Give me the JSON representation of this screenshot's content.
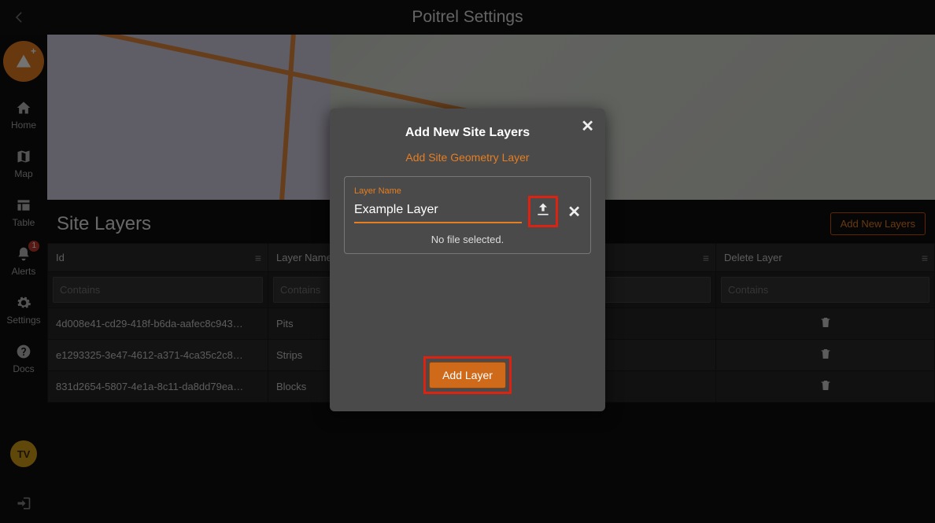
{
  "header": {
    "title": "Poitrel Settings"
  },
  "sidebar": {
    "items": [
      {
        "label": "Home"
      },
      {
        "label": "Map"
      },
      {
        "label": "Table"
      },
      {
        "label": "Alerts",
        "badge": "1"
      },
      {
        "label": "Settings"
      },
      {
        "label": "Docs"
      }
    ],
    "avatar": "TV"
  },
  "section": {
    "title": "Site Layers",
    "add_button": "Add New Layers"
  },
  "table": {
    "columns": [
      {
        "label": "Id",
        "filter": "Contains"
      },
      {
        "label": "Layer Name",
        "filter": "Contains"
      },
      {
        "label": "Delete Layer",
        "filter": "Contains"
      }
    ],
    "rows": [
      {
        "id": "4d008e41-cd29-418f-b6da-aafec8c943…",
        "name": "Pits"
      },
      {
        "id": "e1293325-3e47-4612-a371-4ca35c2c8…",
        "name": "Strips"
      },
      {
        "id": "831d2654-5807-4e1a-8c11-da8dd79ea…",
        "name": "Blocks"
      }
    ]
  },
  "modal": {
    "title": "Add New Site Layers",
    "subtitle": "Add Site Geometry Layer",
    "field_label": "Layer Name",
    "field_value": "Example Layer",
    "no_file": "No file selected.",
    "add_button": "Add Layer"
  }
}
